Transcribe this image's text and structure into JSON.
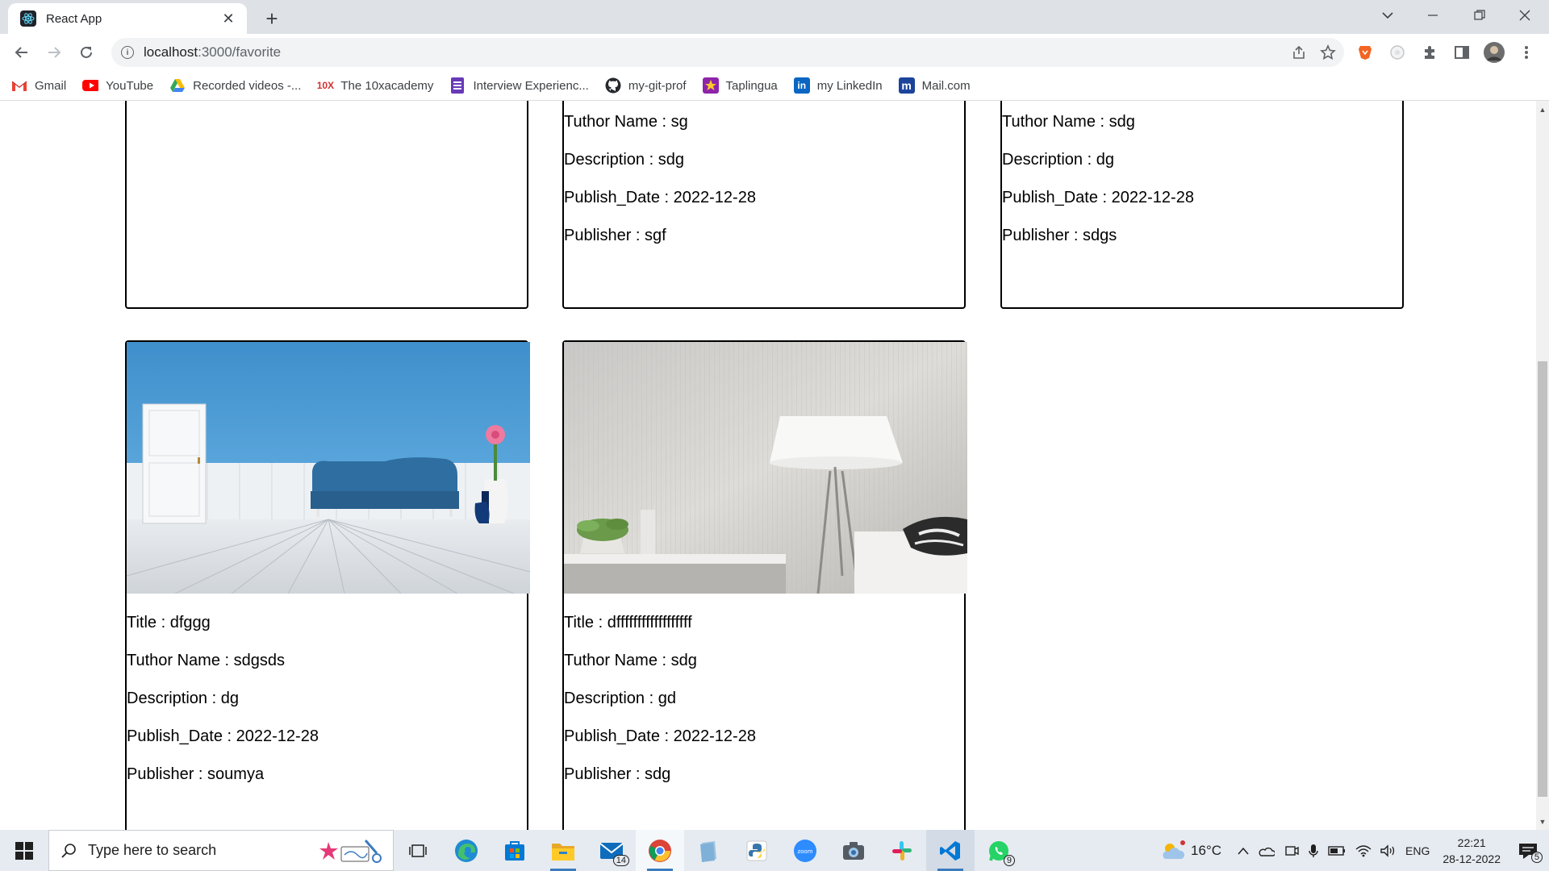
{
  "browser": {
    "tab_title": "React App",
    "url_host": "localhost",
    "url_rest": ":3000/favorite",
    "bookmarks": [
      {
        "label": "Gmail",
        "icon": "gmail-icon",
        "color": "#ea4335"
      },
      {
        "label": "YouTube",
        "icon": "youtube-icon",
        "color": "#ff0000"
      },
      {
        "label": "Recorded videos -...",
        "icon": "google-drive-icon",
        "color": "#34a853"
      },
      {
        "label": "The 10xacademy",
        "icon": "10x-icon",
        "color": "#d32f2f"
      },
      {
        "label": "Interview Experienc...",
        "icon": "forms-icon",
        "color": "#673ab7"
      },
      {
        "label": "my-git-prof",
        "icon": "github-icon",
        "color": "#24292e"
      },
      {
        "label": "Taplingua",
        "icon": "taplingua-icon",
        "color": "#8e24aa"
      },
      {
        "label": "my LinkedIn",
        "icon": "linkedin-icon",
        "color": "#0a66c2"
      },
      {
        "label": "Mail.com",
        "icon": "mailcom-icon",
        "color": "#1c449b"
      }
    ]
  },
  "cards": [
    {
      "has_image": false,
      "tutor": "",
      "description": "",
      "date": "",
      "publisher": ""
    },
    {
      "has_image": false,
      "tutor": "Tuthor Name : sg",
      "description": "Description : sdg",
      "date": "Publish_Date : 2022-12-28",
      "publisher": "Publisher : sgf"
    },
    {
      "has_image": false,
      "tutor": "Tuthor Name : sdg",
      "description": "Description : dg",
      "date": "Publish_Date : 2022-12-28",
      "publisher": "Publisher : sdgs"
    },
    {
      "has_image": true,
      "image": "blue-room-sofa-photo",
      "title": "Title : dfggg",
      "tutor": "Tuthor Name : sdgsds",
      "description": "Description : dg",
      "date": "Publish_Date : 2022-12-28",
      "publisher": "Publisher : soumya"
    },
    {
      "has_image": true,
      "image": "floor-lamp-room-photo",
      "title": "Title : dffffffffffffffffff",
      "tutor": "Tuthor Name : sdg",
      "description": "Description : gd",
      "date": "Publish_Date : 2022-12-28",
      "publisher": "Publisher : sdg"
    }
  ],
  "taskbar": {
    "search_placeholder": "Type here to search",
    "apps": [
      "task-view-icon",
      "edge-icon",
      "store-icon",
      "file-explorer-icon",
      "mail-icon",
      "chrome-icon",
      "files-icon",
      "python-icon",
      "zoom-icon",
      "camera-icon",
      "slack-icon",
      "vscode-icon",
      "whatsapp-icon"
    ],
    "mail_badge": "14",
    "whatsapp_badge": "9",
    "temperature": "16°C",
    "language": "ENG",
    "time": "22:21",
    "date": "28-12-2022",
    "notification_count": "5"
  }
}
